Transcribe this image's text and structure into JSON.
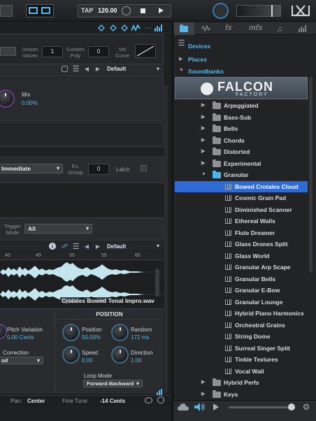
{
  "colors": {
    "accent": "#56b8ea",
    "selection": "#2f6bd6",
    "waveform": "#c3e6ee"
  },
  "transport": {
    "tap_label": "TAP",
    "tempo": "120.00"
  },
  "browser_tabs": [
    "folder-icon",
    "waveform-icon",
    "fx",
    "mfx",
    "note-icon",
    "bars-icon"
  ],
  "browser": {
    "partial_top": "Devices",
    "places": "Places",
    "soundbanks": "Soundbanks",
    "banner_brand": "FALCON",
    "banner_sub": "FACTORY",
    "folders_before": [
      "Arpeggiated",
      "Bass-Sub",
      "Bells",
      "Chords",
      "Distorted",
      "Experimental"
    ],
    "open_folder": "Granular",
    "files": [
      "Bowed Crotales Cloud",
      "Cosmic Grain Pad",
      "Diminished Scanner",
      "Ethereal Walls",
      "Flute Dreamer",
      "Glass Drones Split",
      "Glass World",
      "Granular Arp Scape",
      "Granular Bells",
      "Granular E-Bow",
      "Granular Lounge",
      "Hybrid Piano Harmonics",
      "Orchestral Grains",
      "String Dome",
      "Surreal Singer Split",
      "Tinkle Textures",
      "Vocal Wall"
    ],
    "selected_file": "Bowed Crotales Cloud",
    "folders_after": [
      "Hybrid Perfs",
      "Keys"
    ]
  },
  "top_panel": {
    "unison_label": "Unison Voices",
    "unison_value": "1",
    "poly_label": "Custom Poly",
    "poly_value": "0",
    "vel_label": "Vel Curve",
    "preset_value": "Default"
  },
  "mix": {
    "label": "Mix",
    "value": "0.00%"
  },
  "trigger": {
    "mode_value": "Immediate",
    "ex_group_label": "Ex. Group",
    "ex_group_value": "0",
    "latch_label": "Latch",
    "trigger_mode_label": "Trigger Mode",
    "trigger_mode_value": "All"
  },
  "sample_editor": {
    "preset_value": "Default",
    "ruler": [
      "40",
      "45",
      "50",
      "55",
      "60"
    ],
    "filename": "Crotales Bowed Tonal Impro.wav"
  },
  "grain": {
    "position_header": "POSITION",
    "pitch_var_label": "Pitch Variation",
    "pitch_var_value": "0.00 Cents",
    "correction_label": "Correction",
    "correction_value": "od",
    "position_label": "Position",
    "position_value": "50.00%",
    "random_label": "Random",
    "random_value": "172 ms",
    "speed_label": "Speed",
    "speed_value": "0.00",
    "direction_label": "Direction",
    "direction_value": "1.00",
    "loop_mode_label": "Loop Mode",
    "loop_mode_value": "Forward-Backward"
  },
  "footer": {
    "pan_label": "Pan:",
    "pan_value": "Center",
    "fine_label": "Fine Tune:",
    "fine_value": "-14 Cents"
  }
}
